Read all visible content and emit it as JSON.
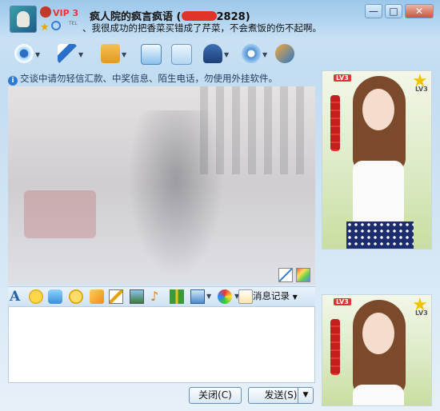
{
  "window": {
    "vip_label": "VIP 3",
    "nickname": "疯人院的疯言疯语",
    "qq_number_visible": "2828",
    "signature": "、我很成功的把香菜买错成了芹菜，不会煮饭的伤不起啊。",
    "tiny_label": "TEL",
    "controls": [
      "minimize",
      "maximize",
      "close"
    ]
  },
  "toolbar": {
    "tools": [
      {
        "icon": "webcam-icon",
        "has_dropdown": true
      },
      {
        "icon": "microphone-icon",
        "has_dropdown": true
      },
      {
        "icon": "file-transfer-icon",
        "has_dropdown": true
      },
      {
        "icon": "screen-capture-icon",
        "has_dropdown": false
      },
      {
        "icon": "add-app-icon",
        "has_dropdown": false
      },
      {
        "icon": "remote-assistance-icon",
        "has_dropdown": true
      },
      {
        "icon": "settings-icon",
        "has_dropdown": true
      },
      {
        "icon": "more-apps-icon",
        "has_dropdown": false
      }
    ]
  },
  "notice": "交谈中请勿轻信汇款、中奖信息、陌生电话，勿使用外挂软件。",
  "format_bar": {
    "tools": [
      "font-icon",
      "emoticon-icon",
      "vibrate-icon",
      "magic-face-icon",
      "scribble-icon",
      "edit-icon",
      "image-icon",
      "music-icon",
      "gift-icon",
      "screenshot-icon",
      "theme-icon"
    ],
    "message_history_label": "消息记录"
  },
  "buttons": {
    "close_label": "关闭(C)",
    "send_label": "发送(S)"
  },
  "profile_panels": {
    "level_badge": "LV3",
    "level_text": "LV3"
  },
  "colors": {
    "title_bar": "#9cc7ea",
    "vip": "#ee3333",
    "accent": "#2d7ad6"
  }
}
